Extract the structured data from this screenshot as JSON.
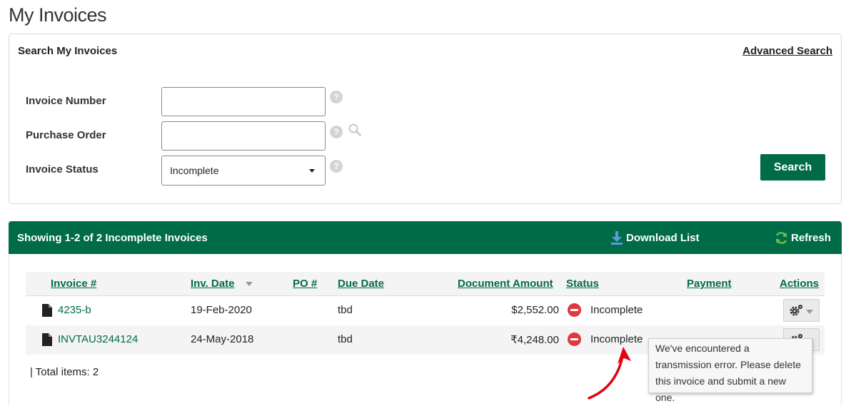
{
  "page": {
    "title": "My Invoices"
  },
  "search": {
    "title": "Search My Invoices",
    "advanced_link": "Advanced Search",
    "fields": {
      "invoice_number": {
        "label": "Invoice Number",
        "value": ""
      },
      "purchase_order": {
        "label": "Purchase Order",
        "value": ""
      },
      "invoice_status": {
        "label": "Invoice Status",
        "selected": "Incomplete"
      }
    },
    "button_label": "Search"
  },
  "results": {
    "summary": "Showing 1-2 of 2 Incomplete Invoices",
    "download_label": "Download List",
    "refresh_label": "Refresh",
    "columns": {
      "invoice": "Invoice #",
      "inv_date": "Inv. Date",
      "po": "PO #",
      "due_date": "Due Date",
      "amount": "Document Amount",
      "status": "Status",
      "payment": "Payment",
      "actions": "Actions"
    },
    "rows": [
      {
        "invoice": "4235-b",
        "inv_date": "19-Feb-2020",
        "po": "",
        "due_date": "tbd",
        "amount": "$2,552.00",
        "status": "Incomplete",
        "payment": ""
      },
      {
        "invoice": "INVTAU3244124",
        "inv_date": "24-May-2018",
        "po": "",
        "due_date": "tbd",
        "amount": "₹4,248.00",
        "status": "Incomplete",
        "payment": ""
      }
    ],
    "total_items": "| Total items: 2"
  },
  "tooltip": {
    "text": "We've encountered a transmission error. Please delete this invoice and submit a new one."
  },
  "colors": {
    "brand_green": "#006c47",
    "status_red": "#e0383e",
    "annotation_red": "#e3000f",
    "download_blue": "#5b9bd5",
    "refresh_green": "#6cc24a"
  },
  "icons": {
    "help": "help-icon",
    "search": "search-icon",
    "download": "download-icon",
    "refresh": "refresh-icon",
    "document": "document-icon",
    "status": "no-entry-icon",
    "actions": "gear-icon",
    "annotation": "red-arrow-icon"
  }
}
